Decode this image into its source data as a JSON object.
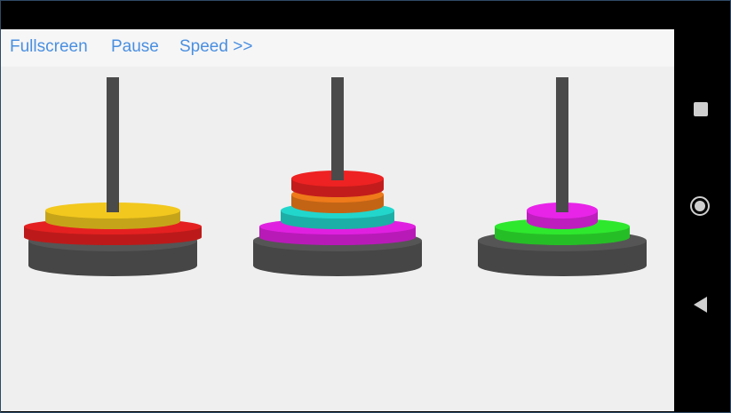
{
  "toolbar": {
    "fullscreen_label": "Fullscreen",
    "pause_label": "Pause",
    "speed_label": "Speed >>"
  },
  "colors": {
    "app_background": "#efefef",
    "toolbar_background": "#f6f6f6",
    "link_text": "#4a8fe0",
    "base": "#555555",
    "peg": "#4a4a4a"
  },
  "nav_bar": {
    "icons": [
      "recents-square-icon",
      "home-circle-icon",
      "back-triangle-icon"
    ]
  },
  "towers": [
    {
      "name": "left",
      "disks": [
        {
          "size": 6,
          "color": "#e52020"
        },
        {
          "size": 4,
          "color": "#f2c81e"
        }
      ]
    },
    {
      "name": "middle",
      "disks": [
        {
          "size": 5,
          "color": "#e020e0"
        },
        {
          "size": 3,
          "color": "#22d6cc"
        },
        {
          "size": 2,
          "color": "#ee7a1a"
        },
        {
          "size": 2,
          "color": "#ee2222"
        }
      ]
    },
    {
      "name": "right",
      "disks": [
        {
          "size": 4,
          "color": "#2ee82e"
        },
        {
          "size": 1,
          "color": "#e824e8"
        }
      ]
    }
  ]
}
